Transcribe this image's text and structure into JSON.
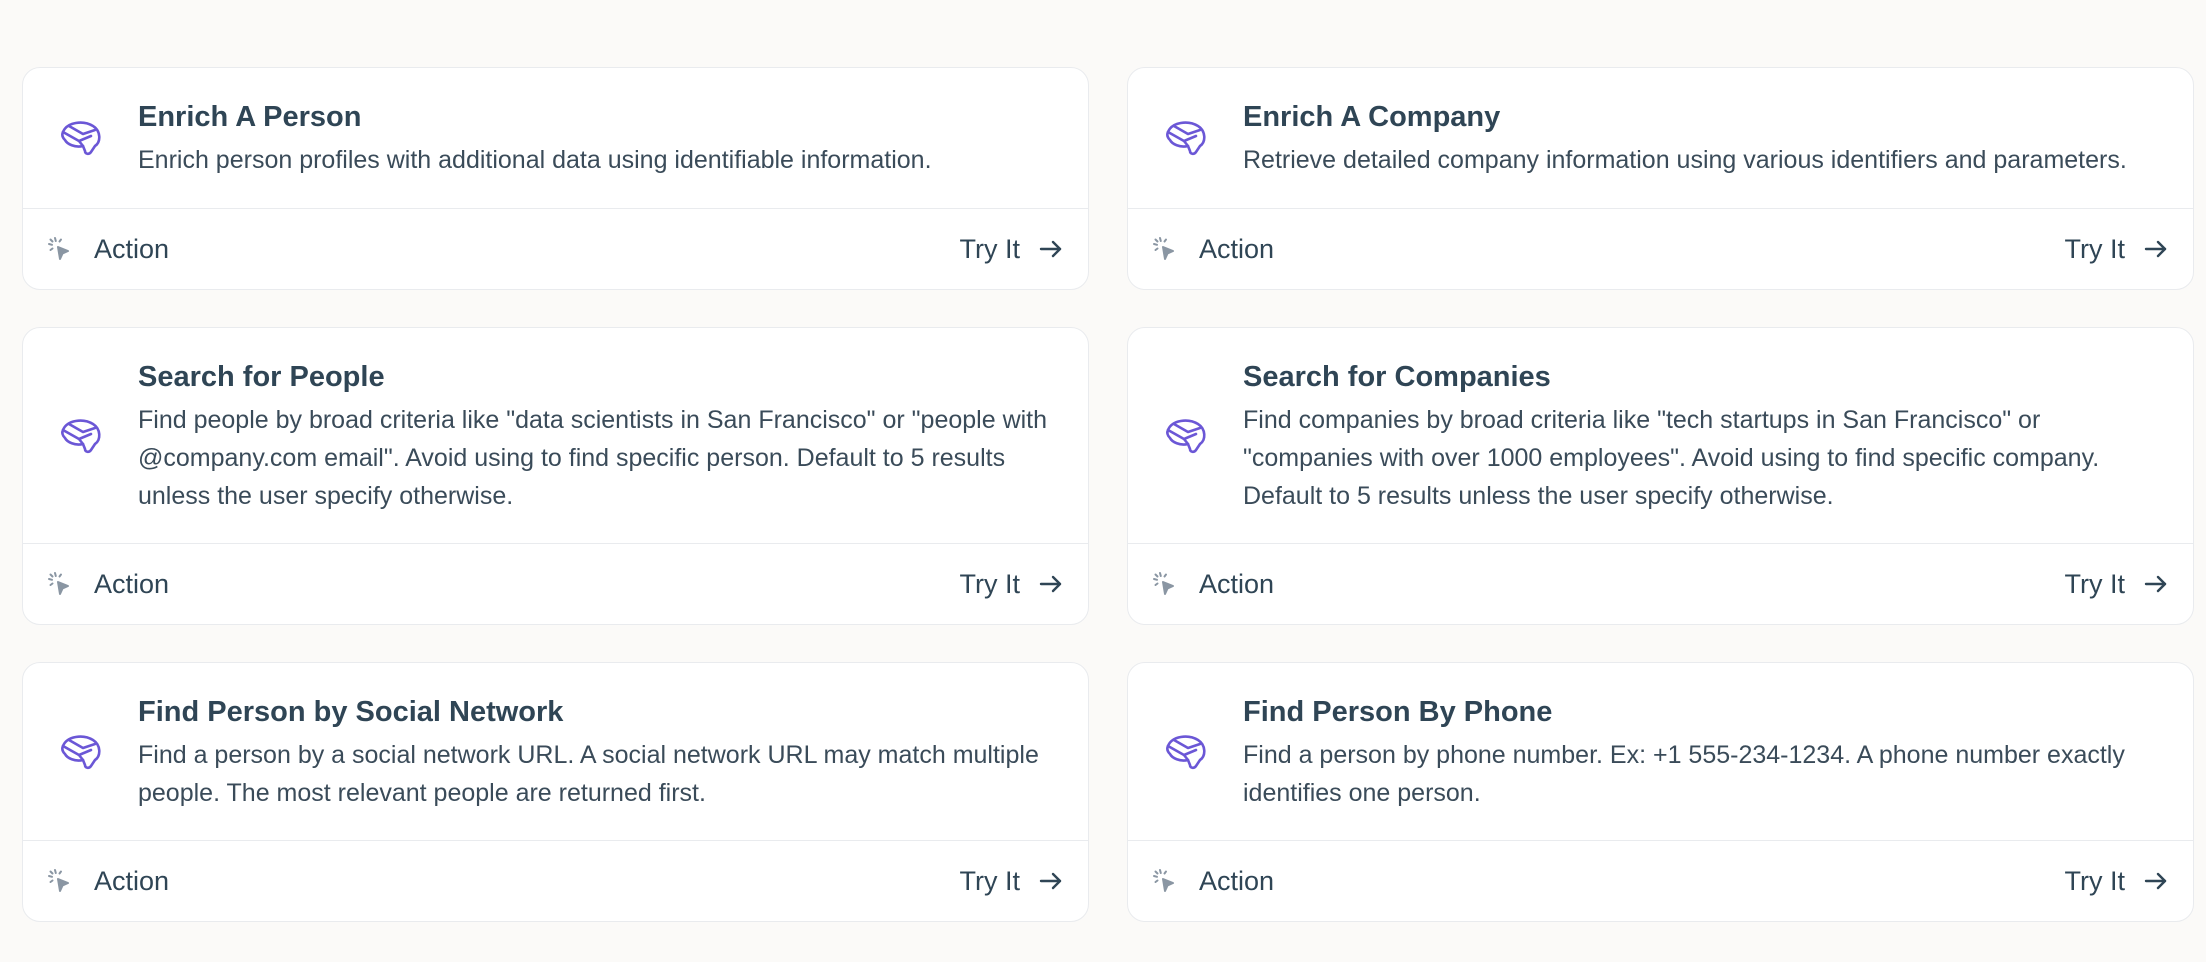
{
  "cards": [
    {
      "title": "Enrich A Person",
      "description": "Enrich person profiles with additional data using identifiable information.",
      "type_label": "Action",
      "cta_label": "Try It"
    },
    {
      "title": "Enrich A Company",
      "description": "Retrieve detailed company information using various identifiers and parameters.",
      "type_label": "Action",
      "cta_label": "Try It"
    },
    {
      "title": "Search for People",
      "description": "Find people by broad criteria like \"data scientists in San Francisco\" or \"people with @company.com email\". Avoid using to find specific person. Default to 5 results unless the user specify otherwise.",
      "type_label": "Action",
      "cta_label": "Try It"
    },
    {
      "title": "Search for Companies",
      "description": "Find companies by broad criteria like \"tech startups in San Francisco\" or \"companies with over 1000 employees\". Avoid using to find specific company. Default to 5 results unless the user specify otherwise.",
      "type_label": "Action",
      "cta_label": "Try It"
    },
    {
      "title": "Find Person by Social Network",
      "description": "Find a person by a social network URL. A social network URL may match multiple people. The most relevant people are returned first.",
      "type_label": "Action",
      "cta_label": "Try It"
    },
    {
      "title": "Find Person By Phone",
      "description": "Find a person by phone number. Ex: +1 555-234-1234. A phone number exactly identifies one person.",
      "type_label": "Action",
      "cta_label": "Try It"
    }
  ],
  "icons": {
    "brand_icon": "brain-logo-icon",
    "action_icon": "cursor-click-icon",
    "cta_icon": "arrow-right-icon"
  },
  "colors": {
    "brand": "#6b57d6",
    "text": "#2f4555",
    "muted_icon": "#8a96a3",
    "border": "#e9ebee",
    "background": "#fbfaf8"
  }
}
